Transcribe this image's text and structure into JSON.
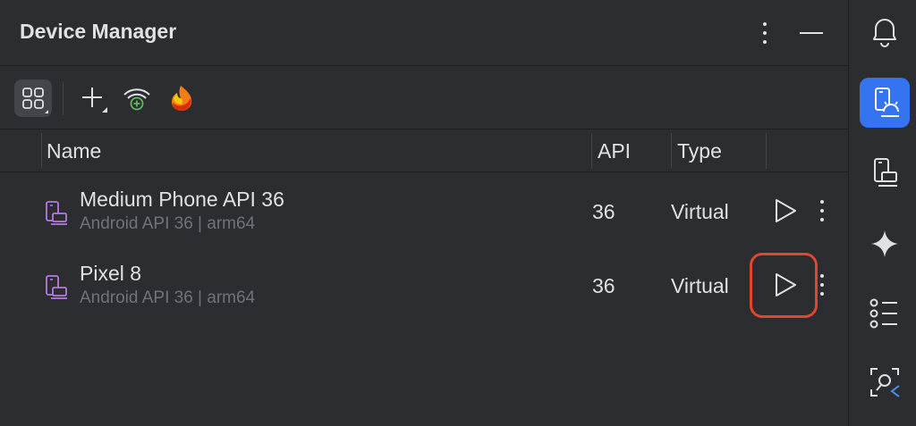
{
  "panel": {
    "title": "Device Manager",
    "header_icons": [
      "more-vertical-icon",
      "minimize-icon"
    ]
  },
  "toolbar": {
    "items": [
      {
        "name": "group-by-icon",
        "selected": true
      },
      {
        "name": "add-device-icon"
      },
      {
        "name": "pair-wifi-icon"
      },
      {
        "name": "firebase-icon"
      }
    ]
  },
  "table": {
    "columns": [
      "Name",
      "API",
      "Type"
    ],
    "rows": [
      {
        "name": "Medium Phone API 36",
        "sub": "Android API 36 | arm64",
        "api": "36",
        "type": "Virtual"
      },
      {
        "name": "Pixel 8",
        "sub": "Android API 36 | arm64",
        "api": "36",
        "type": "Virtual"
      }
    ]
  },
  "sidebar": {
    "items": [
      {
        "name": "notifications-icon"
      },
      {
        "name": "device-manager-icon",
        "active": true
      },
      {
        "name": "running-devices-icon"
      },
      {
        "name": "gemini-icon"
      },
      {
        "name": "build-variants-icon"
      },
      {
        "name": "layout-inspector-icon"
      }
    ]
  },
  "colors": {
    "background": "#2b2d30",
    "text": "#dfe1e5",
    "muted_text": "#6f737a",
    "accent": "#3574f0",
    "highlight": "#e0472e",
    "device_icon": "#b57be0"
  }
}
